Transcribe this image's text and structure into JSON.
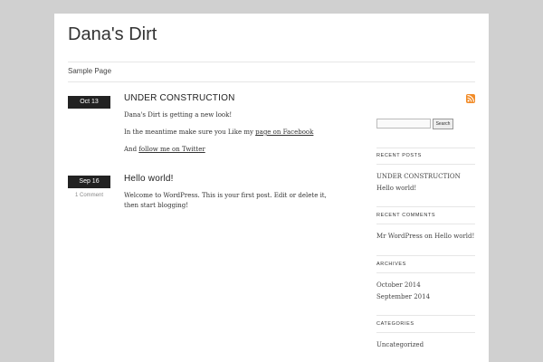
{
  "site": {
    "title": "Dana's Dirt"
  },
  "nav": {
    "items": [
      "Sample Page"
    ]
  },
  "posts": [
    {
      "date": "Oct 13",
      "title": "UNDER CONSTRUCTION",
      "paragraph1": "Dana's Dirt is getting a new look!",
      "paragraph2_text": "In the meantime make sure you Like my ",
      "paragraph2_link": "page on Facebook",
      "paragraph3_text": "And ",
      "paragraph3_link": "follow me on Twitter"
    },
    {
      "date": "Sep 16",
      "comments": "1 Comment",
      "title": "Hello world!",
      "paragraph1": "Welcome to WordPress. This is your first post. Edit or delete it, then start blogging!"
    }
  ],
  "sidebar": {
    "search_button": "Search",
    "search_placeholder": "",
    "recent_posts": {
      "heading": "RECENT POSTS",
      "items": [
        "UNDER CONSTRUCTION",
        "Hello world!"
      ]
    },
    "recent_comments": {
      "heading": "RECENT COMMENTS",
      "author": "Mr WordPress",
      "on": " on ",
      "post": "Hello world!"
    },
    "archives": {
      "heading": "ARCHIVES",
      "items": [
        "October 2014",
        "September 2014"
      ]
    },
    "categories": {
      "heading": "CATEGORIES",
      "items": [
        "Uncategorized"
      ]
    }
  },
  "colors": {
    "background": "#d0d0d0",
    "date_box": "#222222",
    "rss": "#f28c28"
  }
}
